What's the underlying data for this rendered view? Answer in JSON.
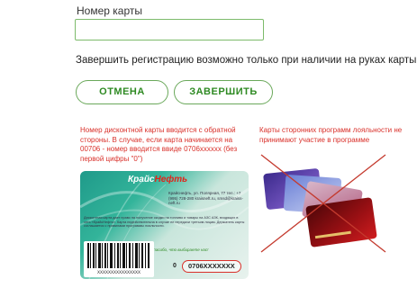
{
  "form": {
    "card_number_label": "Номер карты",
    "card_number_value": "",
    "notice": "Завершить регистрацию возможно только при наличии на руках карты"
  },
  "buttons": {
    "cancel_label": "ОТМЕНА",
    "finish_label": "ЗАВЕРШИТЬ"
  },
  "hints": {
    "left": "Номер дисконтной карты вводится с обратной стороны. В случае, если карта начинается на 00706 - номер вводится ввиде 0706xxxxxx (без первой цифры \"0\")",
    "right": "Карты сторонних программ лояльности не принимают участие в программе"
  },
  "card": {
    "logo_main": "Крайс",
    "logo_accent": "Нефть",
    "address": "Крайснефть, ул. Полярная, 77 тел.: +7 (995) 728-280 kraisneft.ru, smsd@kraiss-neft.ru",
    "small_print": "Дисконтная карта дает право на получение скидки на топливо и товары на АЗС АЗК, входящих в сеть «КрайсНефть». Карта недействительна в случае ее передачи третьим лицам. Держатель карты соглашается с правилами программы лояльности.",
    "thanks": "Спасибо, что выбираете нас!",
    "barcode_number": "XXXXXXXXXXXXXXXX",
    "number_prefix": "0",
    "number": "0706XXXXXXX"
  },
  "colors": {
    "accent": "#2f8a23",
    "border_green": "#7dbb6b",
    "hint_red": "#d9302a"
  }
}
